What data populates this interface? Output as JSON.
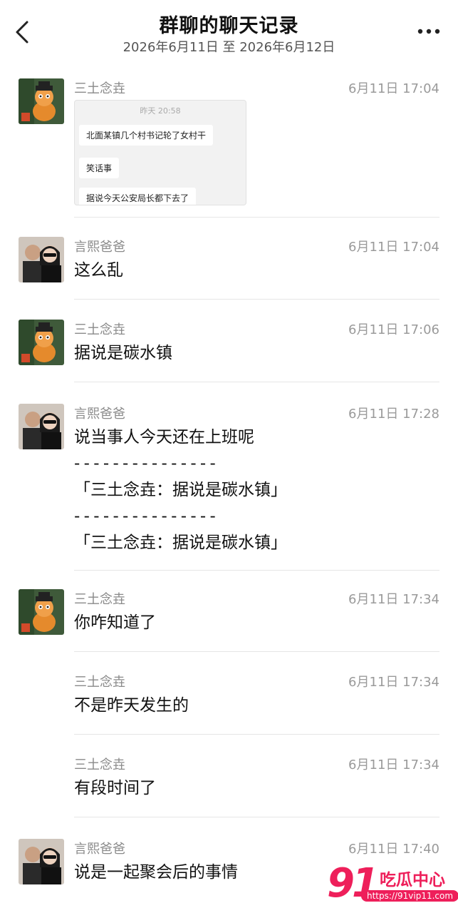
{
  "header": {
    "title": "群聊的聊天记录",
    "date_range": "2026年6月11日 至 2026年6月12日",
    "back_icon": "chevron-left-icon",
    "more_icon": "more-horizontal-icon"
  },
  "messages": [
    {
      "sender": "三土念垚",
      "time": "6月11日 17:04",
      "image": {
        "timestamp": "昨天 20:58",
        "lines": [
          "北面某镇几个村书记轮了女村干",
          "笑话事",
          "据说今天公安局长都下去了"
        ]
      }
    },
    {
      "sender": "言熙爸爸",
      "time": "6月11日 17:04",
      "text": "这么乱"
    },
    {
      "sender": "三土念垚",
      "time": "6月11日 17:06",
      "text": "据说是碳水镇"
    },
    {
      "sender": "言熙爸爸",
      "time": "6月11日 17:28",
      "text": "说当事人今天还在上班呢",
      "quote_separator": "- - - - - - - - - - - - - - -",
      "quote_1": "「三土念垚：据说是碳水镇」",
      "quote_2": "「三土念垚：据说是碳水镇」"
    },
    {
      "sender": "三土念垚",
      "time": "6月11日 17:34",
      "text": "你咋知道了"
    },
    {
      "sender": "三土念垚",
      "time": "6月11日 17:34",
      "text": "不是昨天发生的"
    },
    {
      "sender": "三土念垚",
      "time": "6月11日 17:34",
      "text": "有段时间了"
    },
    {
      "sender": "言熙爸爸",
      "time": "6月11日 17:40",
      "text": "说是一起聚会后的事情"
    }
  ],
  "watermark": {
    "number": "91",
    "label": "吃瓜中心",
    "url": "https://91vip11.com"
  },
  "colors": {
    "watermark": "#ee1f5a",
    "meta_text": "#8a8a8a",
    "divider": "#e6e6e6"
  }
}
